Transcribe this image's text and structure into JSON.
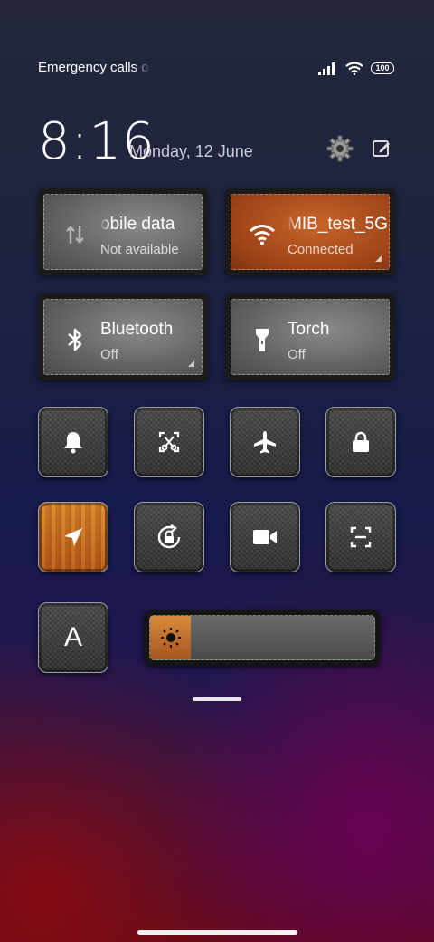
{
  "status_bar": {
    "carrier_text": "Emergency calls o",
    "battery_level": "100"
  },
  "header": {
    "time": "8:16",
    "date": "Monday, 12 June"
  },
  "tiles": {
    "mobile_data": {
      "title": "obile data",
      "status": "Not available"
    },
    "wifi": {
      "title": "MIB_test_5G",
      "status": "Connected"
    },
    "bluetooth": {
      "title": "Bluetooth",
      "status": "Off"
    },
    "torch": {
      "title": "Torch",
      "status": "Off"
    }
  },
  "quick_toggles": [
    {
      "icon": "bell-icon",
      "state": "off"
    },
    {
      "icon": "screenshot-icon",
      "state": "off"
    },
    {
      "icon": "airplane-icon",
      "state": "off"
    },
    {
      "icon": "lock-icon",
      "state": "off"
    },
    {
      "icon": "location-icon",
      "state": "on"
    },
    {
      "icon": "rotation-lock-icon",
      "state": "off"
    },
    {
      "icon": "video-camera-icon",
      "state": "off"
    },
    {
      "icon": "scanner-icon",
      "state": "off"
    }
  ],
  "font_button": {
    "label": "A"
  },
  "brightness": {
    "level_percent": 18
  },
  "colors": {
    "active_orange": "#b5581a",
    "inactive_gray": "#5c5c5c",
    "tile_dark": "#1b1b1b"
  }
}
